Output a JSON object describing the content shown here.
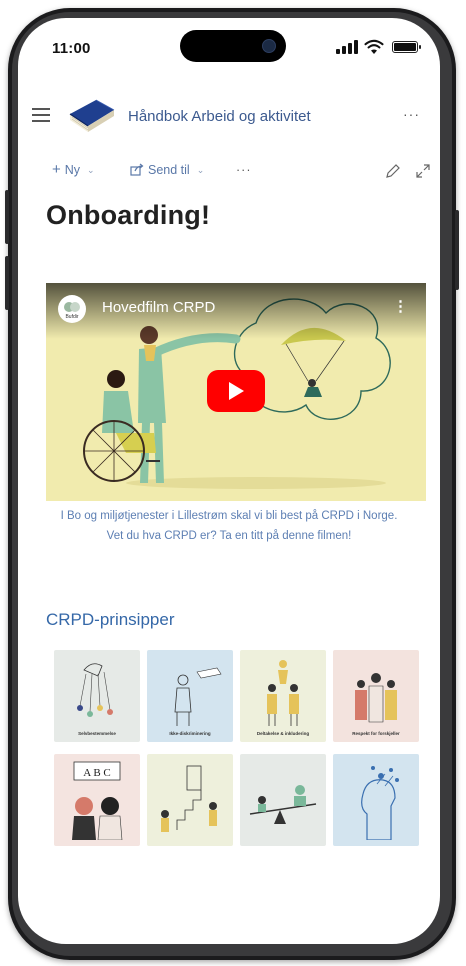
{
  "status": {
    "time": "11:00"
  },
  "header": {
    "site_title": "Håndbok Arbeid og aktivitet",
    "more": "···"
  },
  "toolbar": {
    "new_label": "Ny",
    "send_label": "Send til",
    "more": "···"
  },
  "page": {
    "title": "Onboarding!"
  },
  "video": {
    "title": "Hovedfilm CRPD",
    "channel_badge": "Bufdir"
  },
  "caption": {
    "line1": "I Bo og miljøtjenester i Lillestrøm skal vi bli best på CRPD i Norge.",
    "line2": "Vet du hva CRPD er? Ta en titt på denne filmen!"
  },
  "section": {
    "title": "CRPD-prinsipper"
  },
  "tiles": [
    {
      "label": "Selvbestemmelse",
      "bg": "#e6eae7"
    },
    {
      "label": "Ikke-diskriminering",
      "bg": "#d3e4ef"
    },
    {
      "label": "Deltakelse & inkludering",
      "bg": "#eef0dc"
    },
    {
      "label": "Respekt for forskjeller",
      "bg": "#f3e3de"
    },
    {
      "label": "",
      "bg": "#f4e4e0",
      "text": "A B C"
    },
    {
      "label": "",
      "bg": "#eef0dc"
    },
    {
      "label": "",
      "bg": "#e6eae7"
    },
    {
      "label": "",
      "bg": "#d3e4ef"
    }
  ],
  "colors": {
    "accent": "#3568a8",
    "video_bg": "#f1ebae",
    "play": "#ff0000"
  }
}
